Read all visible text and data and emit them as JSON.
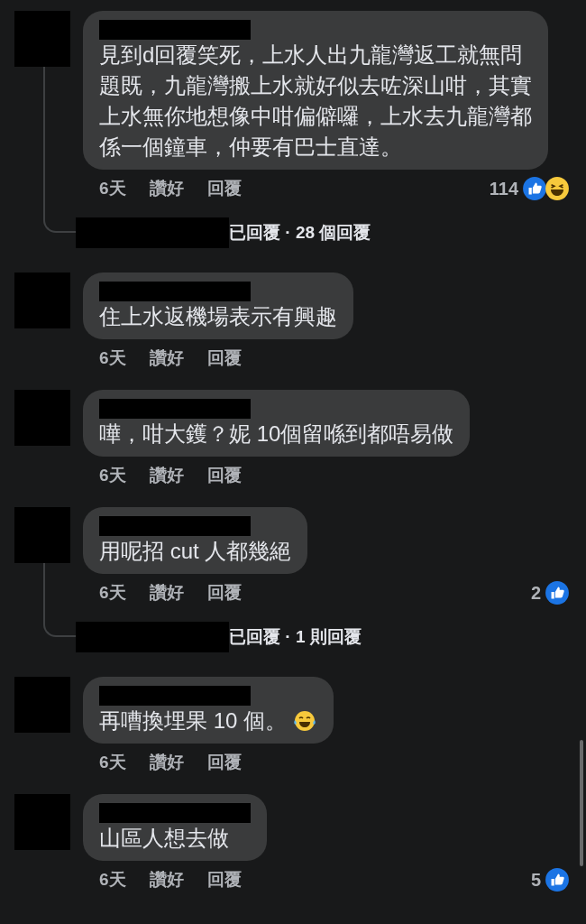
{
  "comments": [
    {
      "text": "見到d回覆笑死，上水人出九龍灣返工就無問題既，九龍灣搬上水就好似去咗深山咁，其實上水無你地想像中咁偏僻囉，上水去九龍灣都係一個鐘車，仲要有巴士直達。",
      "time": "6天",
      "like": "讚好",
      "reply": "回覆",
      "reaction_count": "114",
      "reactions": [
        {
          "kind": "like"
        },
        {
          "kind": "haha"
        }
      ],
      "replies_summary": "已回覆 · 28 個回覆"
    },
    {
      "text": "住上水返機場表示有興趣",
      "time": "6天",
      "like": "讚好",
      "reply": "回覆"
    },
    {
      "text": "嘩，咁大鑊？妮 10個留喺到都唔易做",
      "time": "6天",
      "like": "讚好",
      "reply": "回覆"
    },
    {
      "text": "用呢招 cut 人都幾絕",
      "time": "6天",
      "like": "讚好",
      "reply": "回覆",
      "reaction_count": "2",
      "reactions": [
        {
          "kind": "like"
        }
      ],
      "replies_summary": "已回覆 · 1 則回覆"
    },
    {
      "text": "再嘈換埋果 10 個。",
      "emoji": {
        "kind": "tears_of_joy"
      },
      "time": "6天",
      "like": "讚好",
      "reply": "回覆"
    },
    {
      "text": "山區人想去做",
      "time": "6天",
      "like": "讚好",
      "reply": "回覆",
      "reaction_count": "5",
      "reactions": [
        {
          "kind": "like"
        }
      ]
    }
  ]
}
